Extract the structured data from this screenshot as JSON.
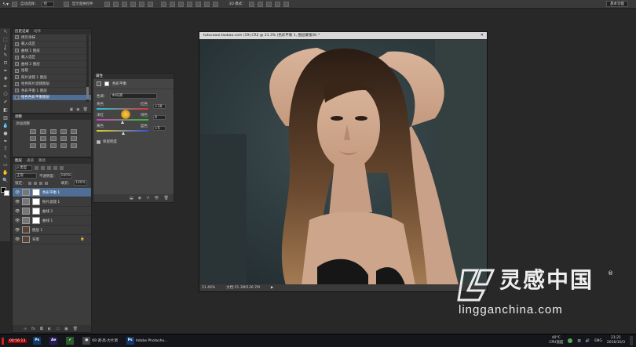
{
  "options_bar": {
    "auto_select_label": "自动选择：",
    "auto_select_value": "组",
    "show_transform_label": "显示变换控件",
    "mode_3d_label": "3D 模式：",
    "workspace_button": "基本功能"
  },
  "toolbar": {
    "tools": [
      "move-icon",
      "marquee-icon",
      "lasso-icon",
      "quick-select-icon",
      "crop-icon",
      "eyedropper-icon",
      "healing-icon",
      "brush-icon",
      "stamp-icon",
      "history-brush-icon",
      "eraser-icon",
      "gradient-icon",
      "blur-icon",
      "dodge-icon",
      "pen-icon",
      "type-icon",
      "path-select-icon",
      "shape-icon",
      "hand-icon",
      "zoom-icon"
    ],
    "tool_glyphs": [
      "↖",
      "⬚",
      "ʆ",
      "✎",
      "⊡",
      "✒",
      "✚",
      "✏",
      "⎔",
      "✐",
      "◧",
      "▥",
      "💧",
      "●",
      "✒",
      "T",
      "↖",
      "▭",
      "✋",
      "🔍"
    ]
  },
  "history_panel": {
    "tabs": [
      "历史记录",
      "动作"
    ],
    "items": [
      "拷贝涂抹",
      "载入选区",
      "曲线 1 图层",
      "载入选区",
      "曲线 2 图层",
      "拾取",
      "照片滤镜 1 图层",
      "拾色照片滤镜图层",
      "色彩平衡 1 图层",
      "拾色色彩平衡图层"
    ],
    "selected_index": 9
  },
  "adjustments_panel": {
    "tabs": [
      "调整"
    ],
    "subtitle": "添加调整"
  },
  "layers_panel": {
    "tabs": [
      "图层",
      "通道",
      "路径"
    ],
    "filter_label": "ρ 类型",
    "blend_mode": "正常",
    "opacity_label": "不透明度：",
    "opacity_value": "100%",
    "lock_label": "锁定：",
    "fill_label": "填充：",
    "fill_value": "100%",
    "layers": [
      {
        "name": "色彩平衡 1",
        "kind": "adj"
      },
      {
        "name": "照片滤镜 1",
        "kind": "adj"
      },
      {
        "name": "曲线 2",
        "kind": "adj"
      },
      {
        "name": "曲线 1",
        "kind": "adj"
      },
      {
        "name": "图层 1",
        "kind": "photo"
      },
      {
        "name": "背景",
        "kind": "photo"
      }
    ],
    "selected_index": 0
  },
  "properties_panel": {
    "tab": "属性",
    "title": "色彩平衡",
    "tone_label": "色调：",
    "tone_value": "中间调",
    "sliders": [
      {
        "left": "青色",
        "right": "红色",
        "value": "+10",
        "level": 0.55,
        "track_color": "#1ec8d8",
        "track_color2": "#e53030"
      },
      {
        "left": "洋红",
        "right": "绿色",
        "value": "0",
        "level": 0.5,
        "track_color": "#d040c0",
        "track_color2": "#30c030"
      },
      {
        "left": "黄色",
        "right": "蓝色",
        "value": "+5",
        "level": 0.52,
        "track_color": "#e8d020",
        "track_color2": "#3050e0"
      }
    ],
    "preserve_label": "保留明度"
  },
  "document": {
    "title": "tutucaoai.taobao.com (19).CR2 @ 21.3% (色彩平衡 1, 图层蒙版/8) *",
    "zoom": "21.46%",
    "doc_size": "文档:51.3M/136.7M"
  },
  "watermark": {
    "brand": "灵感中国",
    "url": "lingganchina.com",
    "reg": "®"
  },
  "taskbar": {
    "apps": [
      {
        "icon": "Ps",
        "label": "",
        "color": "#0f3a6b"
      },
      {
        "icon": "Ae",
        "label": "",
        "color": "#2b1a5a"
      },
      {
        "icon": "✔",
        "label": "",
        "color": "#2b5a2b"
      },
      {
        "icon": "▣",
        "label": "09 调·高·大片调",
        "color": "#444"
      },
      {
        "icon": "Ps",
        "label": "Adobe Photosho...",
        "color": "#0f3a6b"
      }
    ],
    "recording": "00:56:13",
    "temperature": "40°C",
    "cpu_label": "CPU温度",
    "lang": "ENG",
    "time": "21:21",
    "date": "2016/10/3"
  },
  "colors": {
    "selection": "#4f6d95",
    "panel": "#3c3c3c",
    "workspace": "#282828"
  }
}
